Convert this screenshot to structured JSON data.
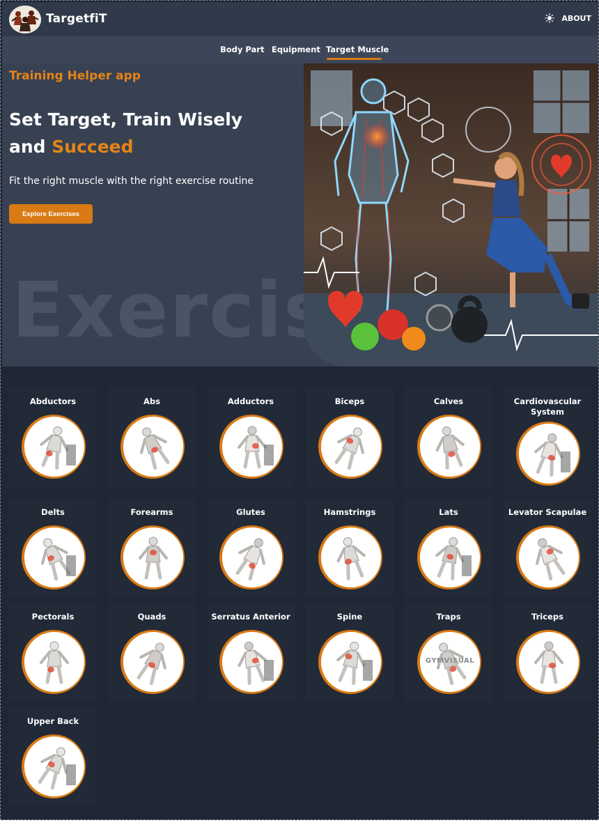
{
  "app": {
    "name": "TargetfiT",
    "about_label": "ABOUT"
  },
  "nav": {
    "items": [
      {
        "label": "Body Part"
      },
      {
        "label": "Equipment"
      },
      {
        "label": "Target Muscle"
      }
    ],
    "active": "Target Muscle"
  },
  "hero": {
    "eyebrow": "Training Helper app",
    "headline_part1": "Set Target, Train Wisely",
    "headline_part2": "and ",
    "headline_accent": "Succeed",
    "subtitle": "Fit the right muscle with the right exercise routine",
    "cta_label": "Explore Exercises",
    "background_word": "Exercise"
  },
  "muscles": [
    {
      "label": "Abductors"
    },
    {
      "label": "Abs"
    },
    {
      "label": "Adductors"
    },
    {
      "label": "Biceps"
    },
    {
      "label": "Calves"
    },
    {
      "label": "Cardiovascular System"
    },
    {
      "label": "Delts"
    },
    {
      "label": "Forearms"
    },
    {
      "label": "Glutes"
    },
    {
      "label": "Hamstrings"
    },
    {
      "label": "Lats"
    },
    {
      "label": "Levator Scapulae"
    },
    {
      "label": "Pectorals"
    },
    {
      "label": "Quads"
    },
    {
      "label": "Serratus Anterior"
    },
    {
      "label": "Spine"
    },
    {
      "label": "Traps"
    },
    {
      "label": "Triceps"
    },
    {
      "label": "Upper Back"
    }
  ],
  "thumb_watermark": "GYMVISUAL",
  "colors": {
    "accent": "#d97a14",
    "page_bg": "#1f2634",
    "card_bg": "#222a38",
    "header_bg": "#313a4a"
  }
}
